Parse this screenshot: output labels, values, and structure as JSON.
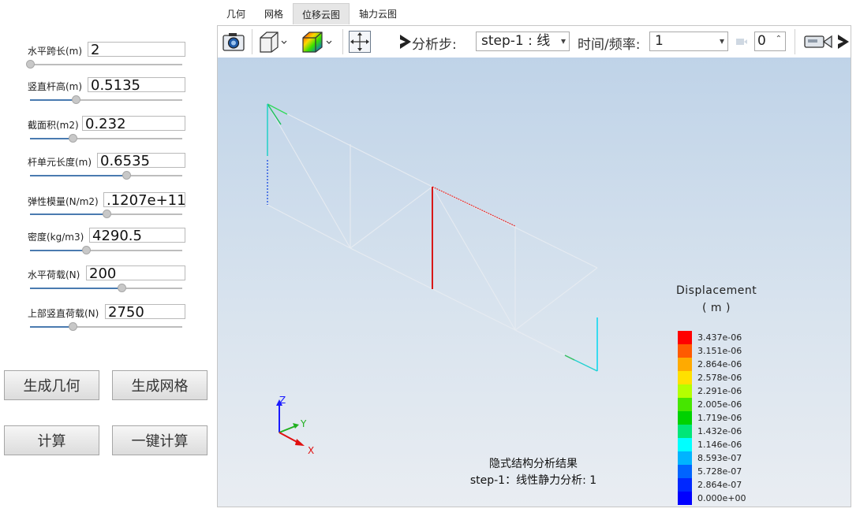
{
  "params": [
    {
      "label": "水平跨长(m)",
      "value": "2",
      "slider": 0.0
    },
    {
      "label": "竖直杆高(m)",
      "value": "0.5135",
      "slider": 0.3
    },
    {
      "label": "截面积(m2)",
      "value": "0.232",
      "slider": 0.28
    },
    {
      "label": "杆单元长度(m)",
      "value": "0.6535",
      "slider": 0.63
    },
    {
      "label": "弹性模量(N/m2)",
      "value": ".1207e+11",
      "slider": 0.5
    },
    {
      "label": "密度(kg/m3)",
      "value": "4290.5",
      "slider": 0.37
    },
    {
      "label": "水平荷载(N)",
      "value": "200",
      "slider": 0.6
    },
    {
      "label": "上部竖直荷载(N)",
      "value": "2750",
      "slider": 0.28
    }
  ],
  "buttons": {
    "gen_geometry": "生成几何",
    "gen_mesh": "生成网格",
    "compute": "计算",
    "one_click": "一键计算"
  },
  "tabs": [
    "几何",
    "网格",
    "位移云图",
    "轴力云图"
  ],
  "active_tab": 2,
  "toolbar": {
    "step_label": "分析步:",
    "step_value": "step-1 : 线",
    "time_label": "时间/频率:",
    "time_value": "1",
    "frame_value": "0"
  },
  "legend": {
    "title": "Displacement",
    "unit": "( m )",
    "entries": [
      {
        "value": "3.437e-06",
        "color": "#ff0000"
      },
      {
        "value": "3.151e-06",
        "color": "#ff5a00"
      },
      {
        "value": "2.864e-06",
        "color": "#ffaa00"
      },
      {
        "value": "2.578e-06",
        "color": "#ffe000"
      },
      {
        "value": "2.291e-06",
        "color": "#b4ff00"
      },
      {
        "value": "2.005e-06",
        "color": "#46e600"
      },
      {
        "value": "1.719e-06",
        "color": "#00d200"
      },
      {
        "value": "1.432e-06",
        "color": "#00e678"
      },
      {
        "value": "1.146e-06",
        "color": "#00ffff"
      },
      {
        "value": "8.593e-07",
        "color": "#00b4ff"
      },
      {
        "value": "5.728e-07",
        "color": "#0064ff"
      },
      {
        "value": "2.864e-07",
        "color": "#0028ff"
      },
      {
        "value": "0.000e+00",
        "color": "#0000ff"
      }
    ]
  },
  "axes": {
    "x": "X",
    "y": "Y",
    "z": "Z"
  },
  "caption": {
    "line1": "隐式结构分析结果",
    "line2": "step-1：线性静力分析: 1"
  }
}
